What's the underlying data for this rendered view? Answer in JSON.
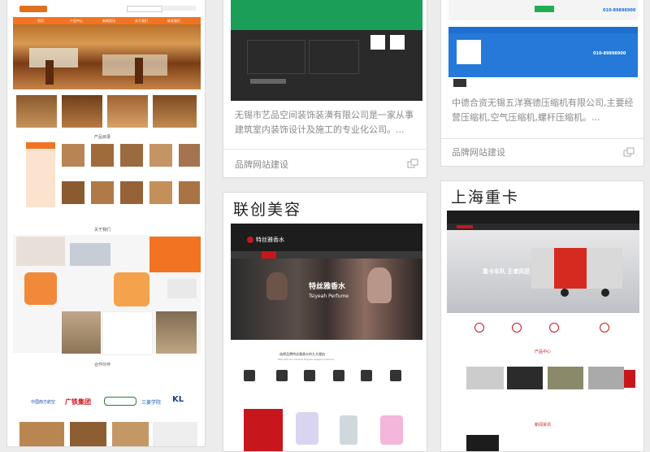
{
  "cards": {
    "left": {
      "header_nav": [
        "首页",
        "产品中心",
        "新闻资讯",
        "关于我们",
        "联系我们"
      ],
      "section_products": "产品目录",
      "section_about": "关于我们",
      "section_partners": "合作伙伴",
      "partners": [
        "中国南方航空",
        "广铁集团",
        "",
        "三菱学院",
        "KL"
      ]
    },
    "middle_top": {
      "desc": "无锡市艺品空间装饰装潢有限公司是一家从事建筑室内装饰设计及施工的专业化公司。...",
      "tag": "品牌网站建设"
    },
    "right_top": {
      "phone1": "010-89898900",
      "phone2": "010-89898900",
      "desc": "中德合资无锡五洋赛德压缩机有限公司,主要经营压缩机,空气压缩机,螺杆压缩机。...",
      "tag": "品牌网站建设"
    },
    "middle_bottom": {
      "title": "联创美容",
      "hero_brand": "特丝雅香水",
      "hero_en": "Tsiyeah Perfume",
      "slogan": "选择品牌特丝雅香水的九大理由",
      "slogan_en": "Why Did You Choose Tsiyeah elegant perfume"
    },
    "right_bottom": {
      "title": "上海重卡",
      "banner_text": "重卡车队 王者风范",
      "section_products": "产品中心",
      "section_news": "新闻资讯"
    }
  },
  "colors": {
    "accent_orange": "#f27422",
    "blue": "#1f6fd0",
    "red": "#c8161d"
  },
  "icons": [
    "expand-icon"
  ]
}
